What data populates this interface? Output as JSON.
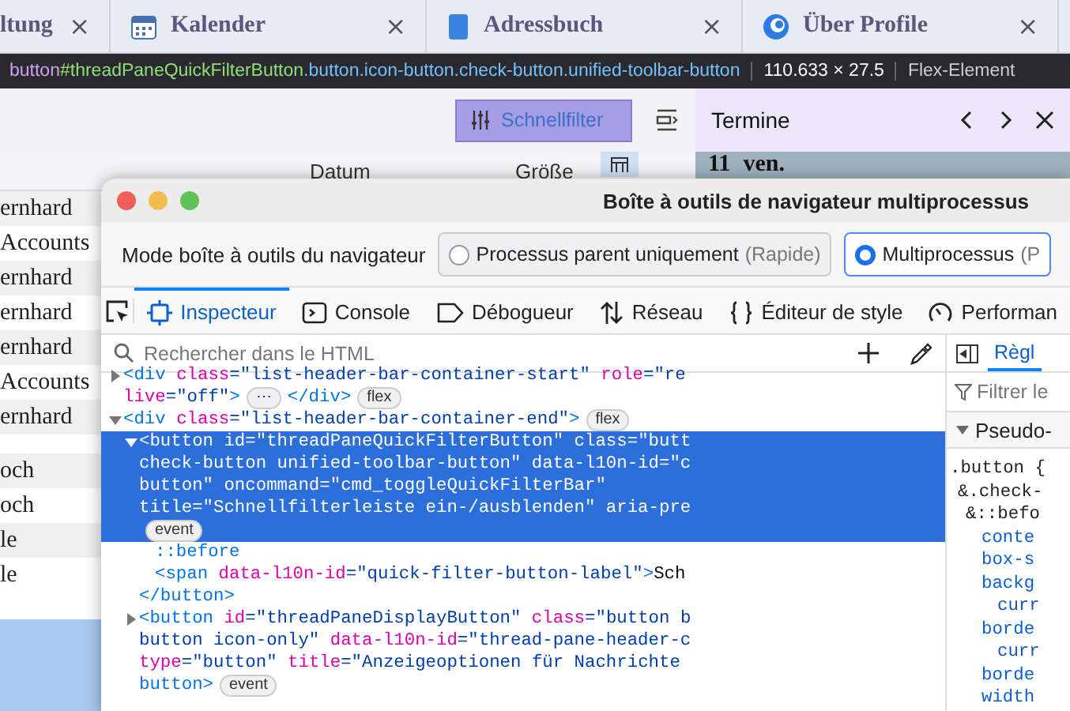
{
  "app_tabs": [
    {
      "label": "ltung",
      "kind": "plain",
      "close": "×"
    },
    {
      "label": "Kalender",
      "kind": "calendar",
      "close": "×"
    },
    {
      "label": "Adressbuch",
      "kind": "addressbook",
      "close": "×"
    },
    {
      "label": "Über Profile",
      "kind": "globe",
      "close": "×"
    }
  ],
  "highlighter_tooltip": {
    "tag": "button",
    "id": "#threadPaneQuickFilterButton",
    "classes": ".button.icon-button.check-button.unified-toolbar-button",
    "size": "110.633 × 27.5",
    "type": "Flex-Element"
  },
  "toolbar": {
    "quick_filter": "Schnellfilter"
  },
  "columns": [
    "Datum",
    "Größe"
  ],
  "calendar_pane": {
    "title": "Termine",
    "day": "11",
    "month": "ven."
  },
  "message_rows": [
    {
      "kind": "message",
      "text": "ernhard"
    },
    {
      "kind": "message",
      "text": "Accounts"
    },
    {
      "kind": "message",
      "text": "ernhard"
    },
    {
      "kind": "message",
      "text": "ernhard"
    },
    {
      "kind": "message",
      "text": "ernhard"
    },
    {
      "kind": "message",
      "text": "Accounts"
    },
    {
      "kind": "message",
      "text": "ernhard"
    },
    {
      "kind": "gap"
    },
    {
      "kind": "message",
      "text": "och"
    },
    {
      "kind": "message",
      "text": "och"
    },
    {
      "kind": "message",
      "text": "le"
    },
    {
      "kind": "message",
      "text": "le"
    }
  ],
  "devtools": {
    "title": "Boîte à outils de navigateur multiprocessus",
    "mode_label": "Mode boîte à outils du navigateur",
    "modes": [
      {
        "label": "Processus parent uniquement",
        "hint": "(Rapide)",
        "selected": false
      },
      {
        "label": "Multiprocessus",
        "hint": "(P",
        "selected": true
      }
    ],
    "tabs": [
      {
        "label": "Inspecteur",
        "kind": "inspector",
        "selected": true
      },
      {
        "label": "Console",
        "kind": "console",
        "selected": false
      },
      {
        "label": "Débogueur",
        "kind": "debugger",
        "selected": false
      },
      {
        "label": "Réseau",
        "kind": "network",
        "selected": false
      },
      {
        "label": "Éditeur de style",
        "kind": "style",
        "selected": false
      },
      {
        "label": "Performan",
        "kind": "performance",
        "selected": false
      }
    ],
    "search_placeholder": "Rechercher dans le HTML",
    "markup": [
      {
        "kind": "parent",
        "expanded": false,
        "selected": false,
        "lines": [
          [
            {
              "kind": "tag",
              "text": "<div"
            },
            {
              "kind": "attr",
              "text": " class"
            },
            {
              "kind": "value",
              "text": "=\"list-header-bar-container-start\""
            },
            {
              "kind": "attr",
              "text": " role"
            },
            {
              "kind": "value",
              "text": "=\"re"
            }
          ],
          [
            {
              "kind": "attr",
              "text": "live"
            },
            {
              "kind": "value",
              "text": "=\"off\""
            },
            {
              "kind": "tag",
              "text": ">"
            },
            {
              "kind": "badge",
              "text": "⋯"
            },
            {
              "kind": "tag",
              "text": "</div>"
            },
            {
              "kind": "badge",
              "text": "flex"
            }
          ]
        ]
      },
      {
        "kind": "parent",
        "expanded": true,
        "selected": false,
        "lines": [
          [
            {
              "kind": "tag",
              "text": "<div"
            },
            {
              "kind": "attr",
              "text": " class"
            },
            {
              "kind": "value",
              "text": "=\"list-header-bar-container-end\""
            },
            {
              "kind": "tag",
              "text": ">"
            },
            {
              "kind": "badge",
              "text": "flex"
            }
          ]
        ],
        "children": [
          {
            "kind": "parent",
            "expanded": true,
            "selected": true,
            "lines": [
              [
                {
                  "kind": "tag",
                  "text": "<button"
                },
                {
                  "kind": "attr",
                  "text": " id"
                },
                {
                  "kind": "value",
                  "text": "=\"threadPaneQuickFilterButton\""
                },
                {
                  "kind": "attr",
                  "text": " class"
                },
                {
                  "kind": "value",
                  "text": "=\"butt"
                }
              ],
              [
                {
                  "kind": "value",
                  "text": "check-button unified-toolbar-button\""
                },
                {
                  "kind": "attr",
                  "text": " data-l10n-id"
                },
                {
                  "kind": "value",
                  "text": "=\"c"
                }
              ],
              [
                {
                  "kind": "value",
                  "text": "button\""
                },
                {
                  "kind": "attr",
                  "text": " oncommand"
                },
                {
                  "kind": "value",
                  "text": "=\"cmd_toggleQuickFilterBar\""
                }
              ],
              [
                {
                  "kind": "attr",
                  "text": "title"
                },
                {
                  "kind": "value",
                  "text": "=\"Schnellfilterleiste ein-/ausblenden\""
                },
                {
                  "kind": "attr",
                  "text": " aria-pre"
                }
              ],
              [
                {
                  "kind": "badge",
                  "text": "event"
                }
              ]
            ],
            "children": [
              {
                "kind": "leaf",
                "lines": [
                  [
                    {
                      "kind": "pseudo",
                      "text": "::before"
                    }
                  ]
                ]
              },
              {
                "kind": "leaf",
                "lines": [
                  [
                    {
                      "kind": "tag",
                      "text": "<span"
                    },
                    {
                      "kind": "attr",
                      "text": " data-l10n-id"
                    },
                    {
                      "kind": "value",
                      "text": "=\"quick-filter-button-label\""
                    },
                    {
                      "kind": "tag",
                      "text": ">"
                    },
                    {
                      "kind": "text",
                      "text": "Sch"
                    }
                  ]
                ]
              }
            ],
            "closing": [
              {
                "kind": "tag",
                "text": "</button>"
              }
            ]
          },
          {
            "kind": "parent",
            "expanded": false,
            "selected": false,
            "lines": [
              [
                {
                  "kind": "tag",
                  "text": "<button"
                },
                {
                  "kind": "attr",
                  "text": " id"
                },
                {
                  "kind": "value",
                  "text": "=\"threadPaneDisplayButton\""
                },
                {
                  "kind": "attr",
                  "text": " class"
                },
                {
                  "kind": "value",
                  "text": "=\"button b"
                }
              ],
              [
                {
                  "kind": "value",
                  "text": "button icon-only\""
                },
                {
                  "kind": "attr",
                  "text": " data-l10n-id"
                },
                {
                  "kind": "value",
                  "text": "=\"thread-pane-header-c"
                }
              ],
              [
                {
                  "kind": "attr",
                  "text": "type"
                },
                {
                  "kind": "value",
                  "text": "=\"button\""
                },
                {
                  "kind": "attr",
                  "text": " title"
                },
                {
                  "kind": "value",
                  "text": "=\"Anzeigeoptionen für Nachrichte"
                }
              ],
              [
                {
                  "kind": "tag",
                  "text": "button>"
                },
                {
                  "kind": "badge",
                  "text": "event"
                }
              ]
            ]
          }
        ]
      }
    ],
    "side_tab": "Règl",
    "filter_placeholder": "Filtrer le",
    "pseudo_heading": "Pseudo-",
    "rules": [
      {
        "kind": "selector",
        "text": ".button {",
        "children": [
          {
            "kind": "selector",
            "text": "&.check-",
            "children": [
              {
                "kind": "selector",
                "text": "&::befo",
                "children": [
                  {
                    "kind": "property",
                    "text": "conte"
                  },
                  {
                    "kind": "property",
                    "text": "box-s"
                  },
                  {
                    "kind": "property",
                    "text": "backg",
                    "children": [
                      {
                        "kind": "value",
                        "text": "curr"
                      }
                    ]
                  },
                  {
                    "kind": "property",
                    "text": "borde",
                    "children": [
                      {
                        "kind": "value",
                        "text": "curr"
                      }
                    ]
                  },
                  {
                    "kind": "property",
                    "text": "borde"
                  },
                  {
                    "kind": "property",
                    "text": "width"
                  }
                ]
              }
            ]
          }
        ]
      }
    ]
  }
}
